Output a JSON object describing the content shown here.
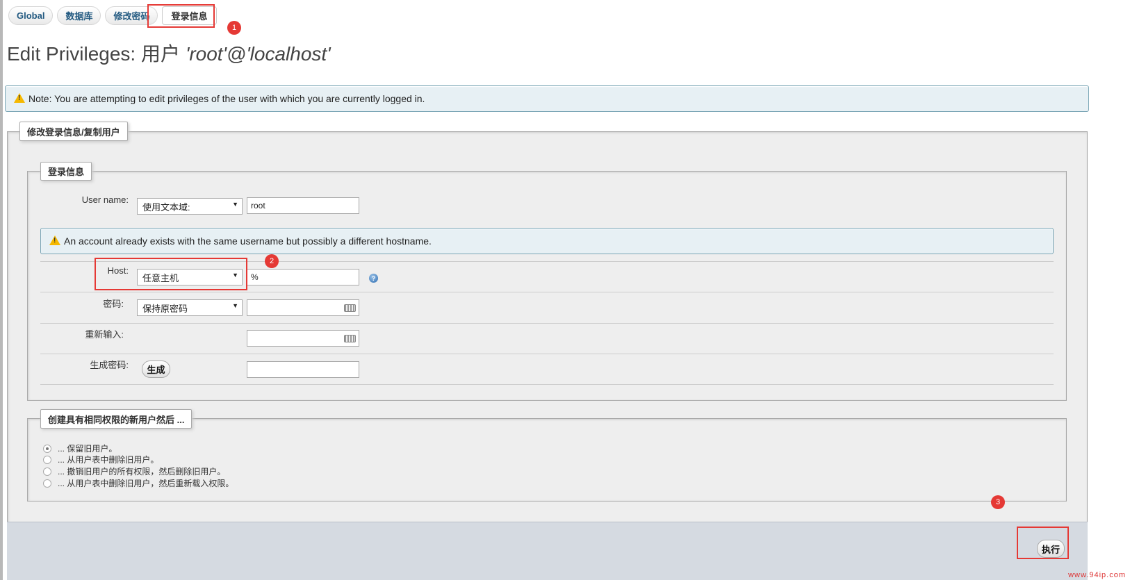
{
  "tabs": [
    {
      "label": "Global",
      "active": false
    },
    {
      "label": "数据库",
      "active": false
    },
    {
      "label": "修改密码",
      "active": false
    },
    {
      "label": "登录信息",
      "active": true
    }
  ],
  "title": {
    "prefix": "Edit Privileges: 用户",
    "user": "'root'@'localhost'"
  },
  "notice_top": "Note: You are attempting to edit privileges of the user with which you are currently logged in.",
  "outer_legend": "修改登录信息/复制用户",
  "login": {
    "legend": "登录信息",
    "username_label": "User name:",
    "username_select": "使用文本域:",
    "username_value": "root",
    "exists_notice": "An account already exists with the same username but possibly a different hostname.",
    "host_label": "Host:",
    "host_select": "任意主机",
    "host_value": "%",
    "password_label": "密码:",
    "password_select": "保持原密码",
    "password_value": "",
    "retype_label": "重新输入:",
    "retype_value": "",
    "generate_label": "生成密码:",
    "generate_button": "生成",
    "generated_value": ""
  },
  "copy": {
    "legend": "创建具有相同权限的新用户然后 ...",
    "options": [
      {
        "label": "... 保留旧用户。",
        "checked": true
      },
      {
        "label": "... 从用户表中删除旧用户。",
        "checked": false
      },
      {
        "label": "... 撤销旧用户的所有权限，然后删除旧用户。",
        "checked": false
      },
      {
        "label": "... 从用户表中删除旧用户，然后重新载入权限。",
        "checked": false
      }
    ]
  },
  "go_button": "执行",
  "annotations": [
    "1",
    "2",
    "3"
  ],
  "watermark": "www.94ip.com",
  "colors": {
    "accent_red": "#e53935",
    "tab_text": "#235a81",
    "notice_bg": "#e7f0f4"
  }
}
